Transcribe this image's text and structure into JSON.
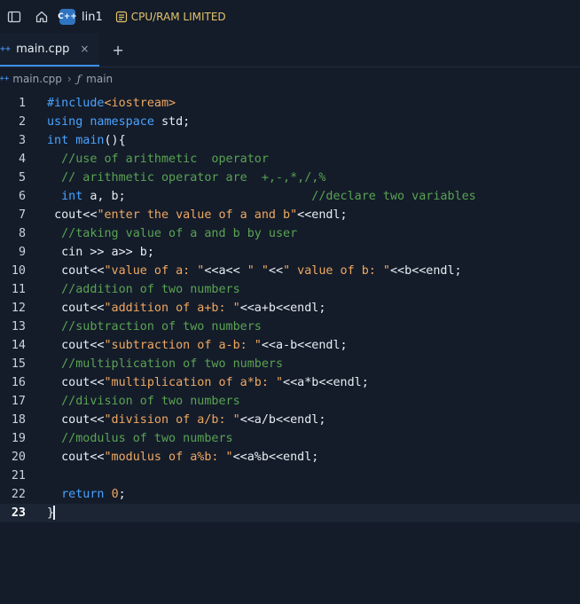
{
  "topbar": {
    "project_name": "lin1",
    "project_icon_text": "C++",
    "limit_label": "CPU/RAM LIMITED"
  },
  "tabs": [
    {
      "label": "main.cpp",
      "icon_text": "C++",
      "close": "×"
    }
  ],
  "tab_add": "+",
  "breadcrumb": {
    "file": "main.cpp",
    "file_icon_text": "C++",
    "separator": "›",
    "symbol_icon": "ƒ",
    "symbol": "main"
  },
  "colors": {
    "keyword": "#4aa3ff",
    "string": "#f0a860",
    "comment": "#5aa352",
    "limit_badge": "#e3c46a",
    "background": "#141c2a"
  },
  "icons": {
    "sidebar_toggle": "sidebar-toggle-icon",
    "home": "home-icon",
    "limit": "gauge-icon"
  },
  "editor": {
    "active_line": 23,
    "lines": [
      {
        "n": "1",
        "indent": "",
        "tokens": [
          [
            "kw",
            "#include"
          ],
          [
            "str",
            "<iostream>"
          ]
        ]
      },
      {
        "n": "2",
        "indent": "",
        "tokens": [
          [
            "kw",
            "using"
          ],
          [
            "pl",
            " "
          ],
          [
            "kw",
            "namespace"
          ],
          [
            "pl",
            " std;"
          ]
        ]
      },
      {
        "n": "3",
        "indent": "",
        "tokens": [
          [
            "kw",
            "int"
          ],
          [
            "pl",
            " "
          ],
          [
            "kw",
            "main"
          ],
          [
            "pl",
            "(){"
          ]
        ]
      },
      {
        "n": "4",
        "indent": "  ",
        "tokens": [
          [
            "cmt",
            "//use of arithmetic  operator"
          ]
        ]
      },
      {
        "n": "5",
        "indent": "  ",
        "tokens": [
          [
            "cmt",
            "// arithmetic operator are  +,-,*,/,%"
          ]
        ]
      },
      {
        "n": "6",
        "indent": "  ",
        "tokens": [
          [
            "kw",
            "int"
          ],
          [
            "pl",
            " a, b;                          "
          ],
          [
            "cmt",
            "//declare two variables"
          ]
        ]
      },
      {
        "n": "7",
        "indent": " ",
        "tokens": [
          [
            "pl",
            "cout<<"
          ],
          [
            "str",
            "\"enter the value of a and b\""
          ],
          [
            "pl",
            "<<endl;"
          ]
        ]
      },
      {
        "n": "8",
        "indent": "  ",
        "tokens": [
          [
            "cmt",
            "//taking value of a and b by user"
          ]
        ]
      },
      {
        "n": "9",
        "indent": "  ",
        "tokens": [
          [
            "pl",
            "cin >> a>> b;"
          ]
        ]
      },
      {
        "n": "10",
        "indent": "  ",
        "tokens": [
          [
            "pl",
            "cout<<"
          ],
          [
            "str",
            "\"value of a: \""
          ],
          [
            "pl",
            "<<a<< "
          ],
          [
            "str",
            "\" \""
          ],
          [
            "pl",
            "<<"
          ],
          [
            "str",
            "\" value of b: \""
          ],
          [
            "pl",
            "<<b<<endl;"
          ]
        ]
      },
      {
        "n": "11",
        "indent": "  ",
        "tokens": [
          [
            "cmt",
            "//addition of two numbers"
          ]
        ]
      },
      {
        "n": "12",
        "indent": "  ",
        "tokens": [
          [
            "pl",
            "cout<<"
          ],
          [
            "str",
            "\"addition of a+b: \""
          ],
          [
            "pl",
            "<<a+b<<endl;"
          ]
        ]
      },
      {
        "n": "13",
        "indent": "  ",
        "tokens": [
          [
            "cmt",
            "//subtraction of two numbers"
          ]
        ]
      },
      {
        "n": "14",
        "indent": "  ",
        "tokens": [
          [
            "pl",
            "cout<<"
          ],
          [
            "str",
            "\"subtraction of a-b: \""
          ],
          [
            "pl",
            "<<a-b<<endl;"
          ]
        ]
      },
      {
        "n": "15",
        "indent": "  ",
        "tokens": [
          [
            "cmt",
            "//multiplication of two numbers"
          ]
        ]
      },
      {
        "n": "16",
        "indent": "  ",
        "tokens": [
          [
            "pl",
            "cout<<"
          ],
          [
            "str",
            "\"multiplication of a*b: \""
          ],
          [
            "pl",
            "<<a*b<<endl;"
          ]
        ]
      },
      {
        "n": "17",
        "indent": "  ",
        "tokens": [
          [
            "cmt",
            "//division of two numbers"
          ]
        ]
      },
      {
        "n": "18",
        "indent": "  ",
        "tokens": [
          [
            "pl",
            "cout<<"
          ],
          [
            "str",
            "\"division of a/b: \""
          ],
          [
            "pl",
            "<<a/b<<endl;"
          ]
        ]
      },
      {
        "n": "19",
        "indent": "  ",
        "tokens": [
          [
            "cmt",
            "//modulus of two numbers"
          ]
        ]
      },
      {
        "n": "20",
        "indent": "  ",
        "tokens": [
          [
            "pl",
            "cout<<"
          ],
          [
            "str",
            "\"modulus of a%b: \""
          ],
          [
            "pl",
            "<<a%b<<endl;"
          ]
        ]
      },
      {
        "n": "21",
        "indent": "  ",
        "tokens": []
      },
      {
        "n": "22",
        "indent": "  ",
        "tokens": [
          [
            "kw",
            "return"
          ],
          [
            "pl",
            " "
          ],
          [
            "num",
            "0"
          ],
          [
            "pl",
            ";"
          ]
        ]
      },
      {
        "n": "23",
        "indent": "",
        "tokens": [
          [
            "pl",
            "}"
          ]
        ]
      }
    ]
  }
}
